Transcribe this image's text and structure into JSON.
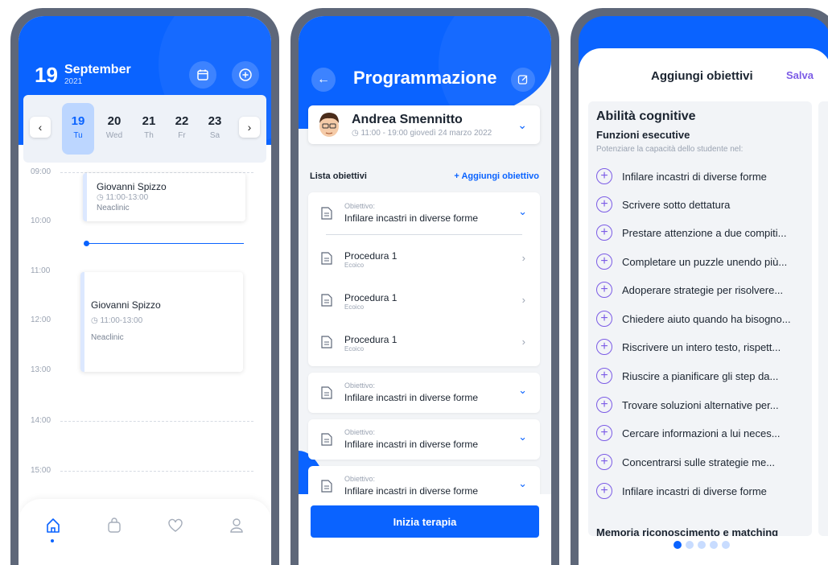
{
  "calendar": {
    "day": "19",
    "month": "September",
    "year": "2021",
    "week": [
      {
        "num": "19",
        "label": "Tu"
      },
      {
        "num": "20",
        "label": "Wed"
      },
      {
        "num": "21",
        "label": "Th"
      },
      {
        "num": "22",
        "label": "Fr"
      },
      {
        "num": "23",
        "label": "Sa"
      }
    ],
    "times": [
      "09:00",
      "10:00",
      "11:00",
      "12:00",
      "13:00",
      "14:00",
      "15:00"
    ],
    "events": [
      {
        "name": "Giovanni Spizzo",
        "time": "11:00-13:00",
        "location": "Neaclinic"
      },
      {
        "name": "Giovanni Spizzo",
        "time": "11:00-13:00",
        "location": "Neaclinic"
      }
    ]
  },
  "program": {
    "title": "Programmazione",
    "patient_name": "Andrea Smennitto",
    "patient_time": "11:00 - 19:00 giovedì 24 marzo 2022",
    "list_title": "Lista obiettivi",
    "add_label": "+ Aggiungi obiettivo",
    "objective_prefix": "Obiettivo:",
    "objective_name": "Infilare incastri in diverse forme",
    "procedures": [
      {
        "name": "Procedura 1",
        "type": "Ecoico"
      },
      {
        "name": "Procedura 1",
        "type": "Ecoico"
      },
      {
        "name": "Procedura 1",
        "type": "Ecoico"
      }
    ],
    "start_button": "Inizia terapia"
  },
  "goals": {
    "title": "Aggiungi obiettivi",
    "save": "Salva",
    "category": "Abilità cognitive",
    "subcategory": "Funzioni esecutive",
    "description": "Potenziare la capacità dello studente nel:",
    "items": [
      "Infilare incastri di diverse forme",
      "Scrivere sotto dettatura",
      "Prestare attenzione a due compiti...",
      "Completare un puzzle unendo più...",
      "Adoperare strategie per risolvere...",
      "Chiedere aiuto quando ha bisogno...",
      "Riscrivere un intero testo, rispett...",
      "Riuscire a pianificare gli step da...",
      "Trovare soluzioni alternative per...",
      "Cercare informazioni a lui neces...",
      "Concentrarsi sulle strategie me...",
      "Infilare incastri di diverse forme"
    ],
    "next_category": "Memoria riconoscimento e matching"
  },
  "colors": {
    "primary": "#0a63ff",
    "accent": "#7c5ce6"
  }
}
